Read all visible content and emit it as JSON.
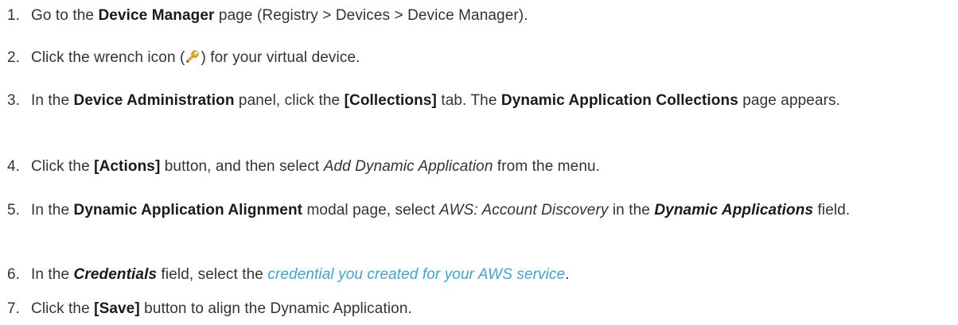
{
  "steps": [
    {
      "number": "1.",
      "parts": [
        "Go to the ",
        "Device Manager",
        " page (Registry > Devices > Device Manager)."
      ]
    },
    {
      "number": "2.",
      "parts": [
        "Click the wrench icon (",
        ") for your virtual device."
      ],
      "icon": "wrench-icon"
    },
    {
      "number": "3.",
      "parts": [
        "In the ",
        "Device Administration",
        " panel, click the ",
        "[Collections]",
        " tab. The ",
        "Dynamic Application Collections",
        " page appears."
      ]
    },
    {
      "number": "4.",
      "parts": [
        "Click the ",
        "[Actions]",
        " button, and then select ",
        "Add Dynamic Application",
        " from the menu."
      ]
    },
    {
      "number": "5.",
      "parts": [
        "In the ",
        "Dynamic Application Alignment",
        " modal page, select ",
        "AWS: Account Discovery",
        " in the ",
        "Dynamic Applications",
        " field."
      ]
    },
    {
      "number": "6.",
      "parts": [
        "In the ",
        "Credentials",
        " field, select the ",
        "credential you created for your AWS service",
        "."
      ]
    },
    {
      "number": "7.",
      "parts": [
        "Click the ",
        "[Save]",
        " button to align the Dynamic Application."
      ]
    }
  ],
  "colors": {
    "text": "#333333",
    "link": "#3aa6d8",
    "icon_wrench": "#f2b01e"
  }
}
